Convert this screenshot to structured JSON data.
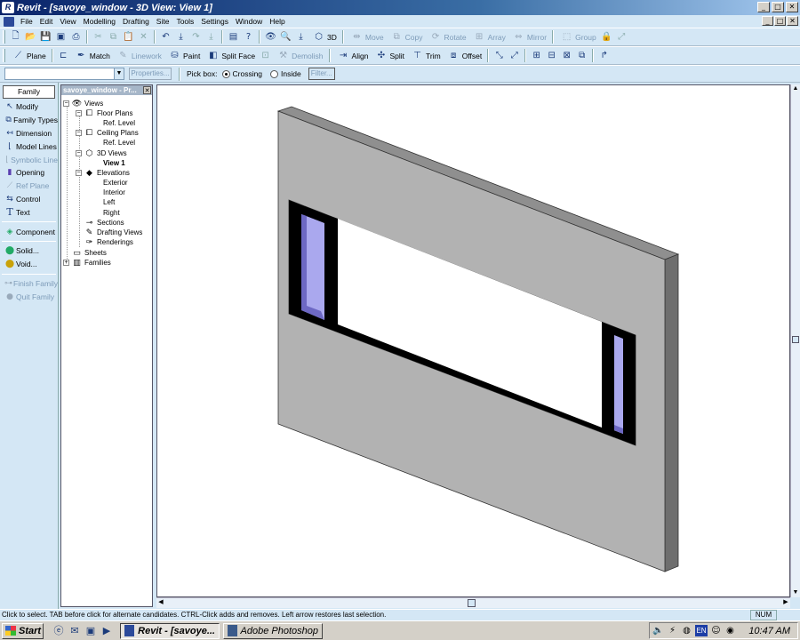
{
  "window": {
    "title": "Revit - [savoye_window - 3D View: View 1]",
    "controls": [
      "_",
      "□",
      "✕"
    ]
  },
  "menu": {
    "items": [
      "File",
      "Edit",
      "View",
      "Modelling",
      "Drafting",
      "Site",
      "Tools",
      "Settings",
      "Window",
      "Help"
    ]
  },
  "toolbar1": {
    "view_3d_label": "3D",
    "move_label": "Move",
    "copy_label": "Copy",
    "rotate_label": "Rotate",
    "array_label": "Array",
    "mirror_label": "Mirror",
    "group_label": "Group"
  },
  "toolbar2": {
    "plane_label": "Plane",
    "match_label": "Match",
    "linework_label": "Linework",
    "paint_label": "Paint",
    "split_face_label": "Split Face",
    "demolish_label": "Demolish",
    "align_label": "Align",
    "split_label": "Split",
    "trim_label": "Trim",
    "offset_label": "Offset"
  },
  "options_bar": {
    "type_value": "",
    "properties_label": "Properties...",
    "pick_box_label": "Pick box:",
    "crossing_label": "Crossing",
    "inside_label": "Inside",
    "filter_label": "Filter..."
  },
  "design_bar": {
    "tab_label": "Family",
    "items": [
      {
        "label": "Modify",
        "icon": "pointer-icon"
      },
      {
        "label": "Family Types",
        "icon": "family-types-icon"
      },
      {
        "label": "Dimension",
        "icon": "dimension-icon"
      },
      {
        "label": "Model Lines",
        "icon": "model-lines-icon"
      },
      {
        "label": "Symbolic Line",
        "icon": "symbolic-line-icon"
      },
      {
        "label": "Opening",
        "icon": "opening-icon"
      },
      {
        "label": "Ref Plane",
        "icon": "ref-plane-icon"
      },
      {
        "label": "Control",
        "icon": "control-icon"
      },
      {
        "label": "Text",
        "icon": "text-icon"
      },
      {
        "label": "Component",
        "icon": "component-icon"
      },
      {
        "label": "Solid...",
        "icon": "solid-icon"
      },
      {
        "label": "Void...",
        "icon": "void-icon"
      },
      {
        "label": "Finish Family",
        "icon": "finish-family-icon"
      },
      {
        "label": "Quit Family",
        "icon": "quit-family-icon"
      }
    ]
  },
  "project_browser": {
    "title": "savoye_window - Pr...",
    "views": "Views",
    "floor_plans": "Floor Plans",
    "floor_ref_level": "Ref. Level",
    "ceiling_plans": "Ceiling Plans",
    "ceiling_ref_level": "Ref. Level",
    "views_3d": "3D Views",
    "view_1": "View 1",
    "elevations": "Elevations",
    "exterior": "Exterior",
    "interior": "Interior",
    "left": "Left",
    "right": "Right",
    "sections": "Sections",
    "drafting_views": "Drafting Views",
    "renderings": "Renderings",
    "sheets": "Sheets",
    "families": "Families"
  },
  "colors": {
    "wall_face": "#b2b2b2",
    "wall_top": "#8f8f8f",
    "wall_edge": "#6e6e6e",
    "frame": "#000000",
    "glass": "#aaa8ee",
    "glass_dark": "#6d68c4"
  },
  "status": {
    "message": "Click to select. TAB before click for alternate candidates. CTRL-Click adds and removes. Left arrow restores last selection.",
    "num": "NUM"
  },
  "taskbar": {
    "start_label": "Start",
    "tasks": [
      {
        "label": "Revit - [savoye...",
        "active": true
      },
      {
        "label": "Adobe Photoshop",
        "active": false
      }
    ],
    "lang": "EN",
    "clock": "10:47 AM"
  }
}
